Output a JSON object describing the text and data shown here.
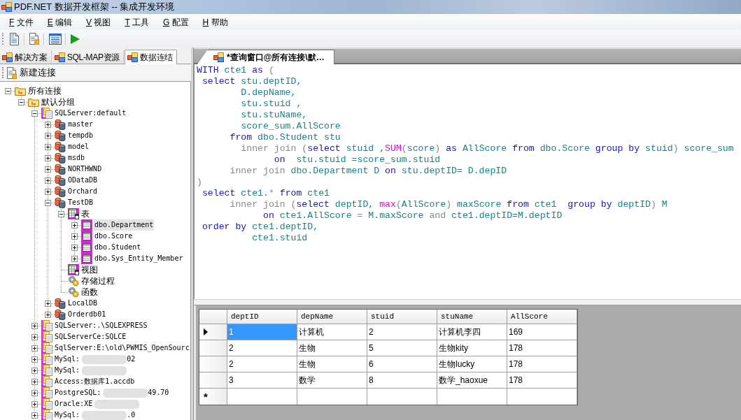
{
  "window": {
    "title": "PDF.NET 数据开发框架 -- 集成开发环境"
  },
  "menu": [
    {
      "hotkey": "F",
      "label": "文件"
    },
    {
      "hotkey": "E",
      "label": "编辑"
    },
    {
      "hotkey": "V",
      "label": "视图"
    },
    {
      "hotkey": "T",
      "label": "工具"
    },
    {
      "hotkey": "G",
      "label": "配置"
    },
    {
      "hotkey": "H",
      "label": "帮助"
    }
  ],
  "left_panel": {
    "tabs": [
      {
        "label": "解决方案",
        "selected": false
      },
      {
        "label": "SQL-MAP资源",
        "selected": false
      },
      {
        "label": "数据连结",
        "selected": true
      }
    ],
    "new_connection": "新建连接",
    "tree": [
      {
        "label": "所有连接",
        "kind": "group",
        "expanded": true,
        "selected": false,
        "children": [
          {
            "label": "默认分组",
            "kind": "group",
            "expanded": true,
            "selected": false,
            "children": [
              {
                "label": "SQLServer:default",
                "kind": "server",
                "expanded": true,
                "selected": false,
                "children": [
                  {
                    "label": "master",
                    "kind": "database",
                    "expanded": false,
                    "selected": false
                  },
                  {
                    "label": "tempdb",
                    "kind": "database",
                    "expanded": false,
                    "selected": false
                  },
                  {
                    "label": "model",
                    "kind": "database",
                    "expanded": false,
                    "selected": false
                  },
                  {
                    "label": "msdb",
                    "kind": "database",
                    "expanded": false,
                    "selected": false
                  },
                  {
                    "label": "NORTHWND",
                    "kind": "database",
                    "expanded": false,
                    "selected": false
                  },
                  {
                    "label": "ODataDB",
                    "kind": "database",
                    "expanded": false,
                    "selected": false
                  },
                  {
                    "label": "Orchard",
                    "kind": "database",
                    "expanded": false,
                    "selected": false
                  },
                  {
                    "label": "TestDB",
                    "kind": "database",
                    "expanded": true,
                    "selected": false,
                    "children": [
                      {
                        "label": "表",
                        "kind": "table_folder",
                        "expanded": true,
                        "selected": false,
                        "children": [
                          {
                            "label": "dbo.Department",
                            "kind": "table",
                            "expanded": false,
                            "selected": true
                          },
                          {
                            "label": "dbo.Score",
                            "kind": "table",
                            "expanded": false,
                            "selected": false
                          },
                          {
                            "label": "dbo.Student",
                            "kind": "table",
                            "expanded": false,
                            "selected": false
                          },
                          {
                            "label": "dbo.Sys_Entity_Member",
                            "kind": "table",
                            "expanded": false,
                            "selected": false
                          }
                        ]
                      },
                      {
                        "label": "视图",
                        "kind": "table_folder",
                        "selected": false
                      },
                      {
                        "label": "存储过程",
                        "kind": "routine",
                        "selected": false
                      },
                      {
                        "label": "函数",
                        "kind": "routine",
                        "selected": false
                      }
                    ]
                  },
                  {
                    "label": "LocalDB",
                    "kind": "database",
                    "expanded": false,
                    "selected": false
                  },
                  {
                    "label": "Orderdb01",
                    "kind": "database",
                    "expanded": false,
                    "selected": false
                  }
                ]
              },
              {
                "label": "SQLServer:.\\SQLEXPRESS",
                "kind": "server",
                "expanded": false,
                "selected": false
              },
              {
                "label": "SQLServerCe:SQLCE",
                "kind": "server",
                "expanded": false,
                "selected": false
              },
              {
                "label": "SqlServer:E:\\old\\PWMIS_OpenSourc",
                "kind": "server",
                "expanded": false,
                "selected": false
              },
              {
                "label": "MySql:",
                "kind": "server",
                "expanded": false,
                "selected": false,
                "redacted": true,
                "label_end": "02"
              },
              {
                "label": "MySql:",
                "kind": "server",
                "expanded": false,
                "selected": false,
                "redacted": true
              },
              {
                "label": "Access:数据库1.accdb",
                "kind": "server",
                "expanded": false,
                "selected": false
              },
              {
                "label": "PostgreSQL:",
                "kind": "server",
                "expanded": false,
                "selected": false,
                "redacted": true,
                "label_end": "49.70"
              },
              {
                "label": "Oracle:XE",
                "kind": "server",
                "expanded": false,
                "selected": false,
                "redacted": true
              },
              {
                "label": "MySql:",
                "kind": "server",
                "expanded": false,
                "selected": false,
                "redacted": true,
                "label_end": ".0"
              }
            ]
          }
        ]
      }
    ]
  },
  "editor": {
    "tab": {
      "title": "*查询窗口@所有连接\\默…",
      "selected": true
    },
    "lines": [
      [
        {
          "kind": "keyword",
          "text": "WITH"
        },
        {
          "kind": "identifier",
          "text": " cte1 "
        },
        {
          "kind": "keyword",
          "text": "as"
        },
        {
          "kind": "operator",
          "text": " ("
        }
      ],
      [
        {
          "kind": "keyword",
          "text": " select"
        },
        {
          "kind": "identifier",
          "text": " stu.deptID,"
        }
      ],
      [
        {
          "kind": "identifier",
          "text": "        D.depName,"
        }
      ],
      [
        {
          "kind": "identifier",
          "text": "        stu.stuid ,"
        }
      ],
      [
        {
          "kind": "identifier",
          "text": "        stu.stuName,"
        }
      ],
      [
        {
          "kind": "identifier",
          "text": "        score_sum.AllScore"
        }
      ],
      [
        {
          "kind": "keyword",
          "text": "      from"
        },
        {
          "kind": "identifier",
          "text": " dbo.Student stu"
        }
      ],
      [
        {
          "kind": "operator",
          "text": "        inner join ("
        },
        {
          "kind": "keyword",
          "text": "select"
        },
        {
          "kind": "identifier",
          "text": " stuid ,"
        },
        {
          "kind": "function",
          "text": "SUM"
        },
        {
          "kind": "operator",
          "text": "("
        },
        {
          "kind": "identifier",
          "text": "score"
        },
        {
          "kind": "operator",
          "text": ") "
        },
        {
          "kind": "keyword",
          "text": "as"
        },
        {
          "kind": "identifier",
          "text": " AllScore "
        },
        {
          "kind": "keyword",
          "text": "from"
        },
        {
          "kind": "identifier",
          "text": " dbo.Score "
        },
        {
          "kind": "keyword",
          "text": "group by"
        },
        {
          "kind": "identifier",
          "text": " stuid"
        },
        {
          "kind": "operator",
          "text": ")"
        },
        {
          "kind": "identifier",
          "text": " score_sum"
        }
      ],
      [
        {
          "kind": "keyword",
          "text": "              on"
        },
        {
          "kind": "identifier",
          "text": "  stu.stuid =score_sum.stuid"
        }
      ],
      [
        {
          "kind": "operator",
          "text": "      inner join"
        },
        {
          "kind": "identifier",
          "text": " dbo.Department D "
        },
        {
          "kind": "keyword",
          "text": "on"
        },
        {
          "kind": "identifier",
          "text": " stu.deptID= D.depID"
        }
      ],
      [
        {
          "kind": "operator",
          "text": ")"
        }
      ],
      [
        {
          "kind": "keyword",
          "text": " select"
        },
        {
          "kind": "identifier",
          "text": " cte1."
        },
        {
          "kind": "operator",
          "text": "*"
        },
        {
          "kind": "keyword",
          "text": " from"
        },
        {
          "kind": "identifier",
          "text": " cte1"
        }
      ],
      [
        {
          "kind": "operator",
          "text": "      inner join ("
        },
        {
          "kind": "keyword",
          "text": "select"
        },
        {
          "kind": "identifier",
          "text": " deptID, "
        },
        {
          "kind": "function",
          "text": "max"
        },
        {
          "kind": "operator",
          "text": "("
        },
        {
          "kind": "identifier",
          "text": "AllScore"
        },
        {
          "kind": "operator",
          "text": ")"
        },
        {
          "kind": "identifier",
          "text": " maxScore "
        },
        {
          "kind": "keyword",
          "text": "from"
        },
        {
          "kind": "identifier",
          "text": " cte1  "
        },
        {
          "kind": "keyword",
          "text": "group by"
        },
        {
          "kind": "identifier",
          "text": " deptID"
        },
        {
          "kind": "operator",
          "text": ")"
        },
        {
          "kind": "identifier",
          "text": " M"
        }
      ],
      [
        {
          "kind": "keyword",
          "text": "            on"
        },
        {
          "kind": "identifier",
          "text": " cte1.AllScore "
        },
        {
          "kind": "operator",
          "text": "="
        },
        {
          "kind": "identifier",
          "text": " M.maxScore "
        },
        {
          "kind": "operator",
          "text": "and"
        },
        {
          "kind": "identifier",
          "text": " cte1.deptID=M.deptID"
        }
      ],
      [
        {
          "kind": "keyword",
          "text": " order by"
        },
        {
          "kind": "identifier",
          "text": " cte1.deptID,"
        }
      ],
      [
        {
          "kind": "identifier",
          "text": "          cte1.stuid"
        }
      ]
    ]
  },
  "results": {
    "columns": [
      "deptID",
      "depName",
      "stuid",
      "stuName",
      "AllScore"
    ],
    "rows": [
      {
        "current": true,
        "cells": [
          {
            "text": "1",
            "selected": true
          },
          {
            "text": "计算机",
            "selected": false
          },
          {
            "text": "2",
            "selected": false
          },
          {
            "text": "计算机李四",
            "selected": false
          },
          {
            "text": "169",
            "selected": false
          }
        ]
      },
      {
        "current": false,
        "cells": [
          {
            "text": "2",
            "selected": false
          },
          {
            "text": "生物",
            "selected": false
          },
          {
            "text": "5",
            "selected": false
          },
          {
            "text": "生物kity",
            "selected": false
          },
          {
            "text": "178",
            "selected": false
          }
        ]
      },
      {
        "current": false,
        "cells": [
          {
            "text": "2",
            "selected": false
          },
          {
            "text": "生物",
            "selected": false
          },
          {
            "text": "6",
            "selected": false
          },
          {
            "text": "生物lucky",
            "selected": false
          },
          {
            "text": "178",
            "selected": false
          }
        ]
      },
      {
        "current": false,
        "cells": [
          {
            "text": "3",
            "selected": false
          },
          {
            "text": "数学",
            "selected": false
          },
          {
            "text": "8",
            "selected": false
          },
          {
            "text": "数学_haoxue",
            "selected": false
          },
          {
            "text": "178",
            "selected": false
          }
        ]
      }
    ],
    "new_row_marker": "*"
  }
}
